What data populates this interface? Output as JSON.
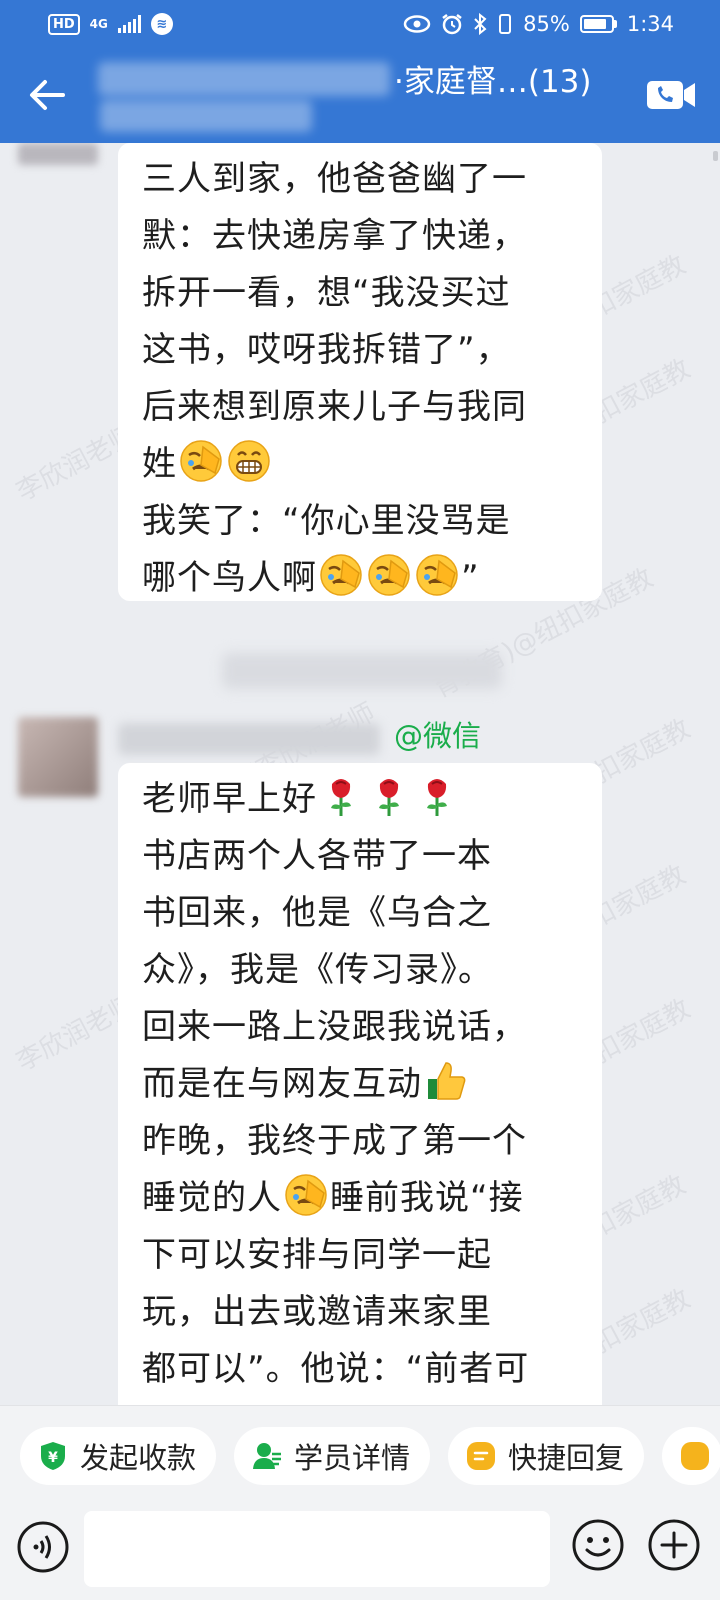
{
  "status_bar": {
    "hd": "HD",
    "signal": "4G",
    "battery": "85%",
    "time": "1:34"
  },
  "header": {
    "title_visible": "·家庭督…(13)"
  },
  "messages": [
    {
      "lines": [
        "三人到家，他爸爸幽了一",
        "默：去快递房拿了快递，",
        "拆开一看，想“我没买过",
        "这书，哎呀我拆错了”，",
        "后来想到原来儿子与我同",
        "姓",
        "我笑了：“你心里没骂是",
        "哪个鸟人啊",
        "”"
      ]
    },
    {
      "sender_tag": "@微信",
      "lines": [
        "老师早上好",
        "书店两个人各带了一本",
        "书回来，他是《乌合之",
        "众》，我是《传习录》。",
        "回来一路上没跟我说话，",
        "而是在与网友互动",
        "昨晚，我终于成了第一个",
        "睡觉的人",
        "睡前我说“接",
        "下可以安排与同学一起",
        "玩，出去或邀请来家里",
        "都可以”。他说：“前者可"
      ]
    }
  ],
  "watermark": "李欣润老师—纽扣家庭教育)@纽扣家庭",
  "quick_actions": [
    {
      "label": "发起收款",
      "icon": "payment-icon"
    },
    {
      "label": "学员详情",
      "icon": "student-icon"
    },
    {
      "label": "快捷回复",
      "icon": "quick-reply-icon"
    }
  ],
  "colors": {
    "header": "#3577d4",
    "wechat_green": "#1aad4b",
    "reply_yellow": "#f5b31c"
  }
}
